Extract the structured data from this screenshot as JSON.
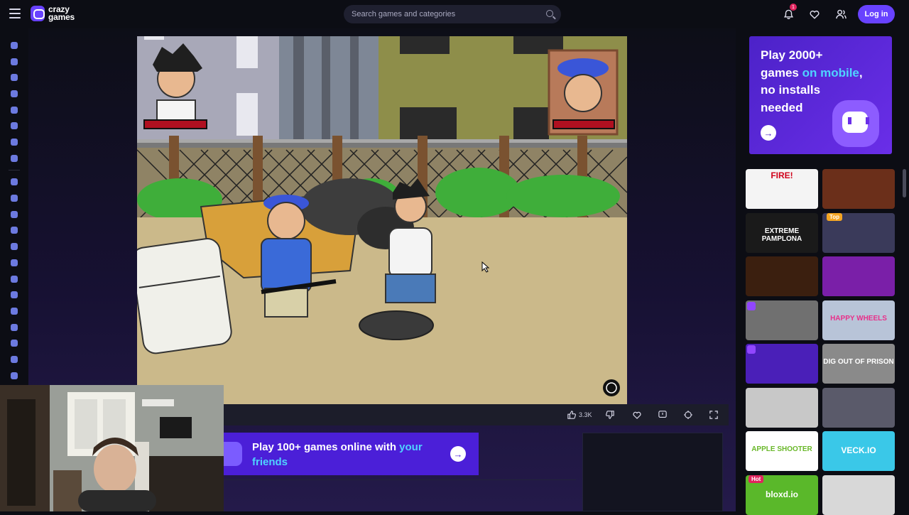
{
  "header": {
    "logo_line1": "crazy",
    "logo_line2": "games",
    "search_placeholder": "Search games and categories",
    "notification_count": "1",
    "login_label": "Log in"
  },
  "colors": {
    "accent": "#6842ff",
    "banner": "#4b1fd8",
    "highlight": "#4fd3ff",
    "badge_red": "#e0245e"
  },
  "sidebar": {
    "icons": [
      "home-icon",
      "recent-icon",
      "new-icon",
      "trending-icon",
      "updated-icon",
      "originals-icon",
      "multiplayer-icon",
      "leaderboard-icon",
      "action-icon",
      "adventure-icon",
      "basketball-icon",
      "beauty-icon",
      "car-icon",
      "clicker-icon",
      "casual-icon",
      "driving-icon",
      "controller-icon",
      "io-icon",
      "mahjong-icon",
      "puzzle-icon",
      "shooting-icon"
    ]
  },
  "game_toolbar": {
    "like_count": "3.3K",
    "icons": [
      "thumbs-up-icon",
      "thumbs-down-icon",
      "heart-icon",
      "report-icon",
      "theater-icon",
      "fullscreen-icon"
    ]
  },
  "bottom_banner": {
    "text_plain": "Play 100+ games online with ",
    "text_highlight": "your friends"
  },
  "promo": {
    "line1": "Play 2000+",
    "line2a": "games ",
    "line2b": "on mobile",
    "line2c": ",",
    "line3": "no installs",
    "line4": "needed"
  },
  "thumbnails": [
    {
      "name": "fire-game-thumb",
      "label": "FIRE!",
      "color": "#f4f4f4",
      "text": "#d0021b"
    },
    {
      "name": "boxing-game-thumb",
      "label": "",
      "color": "#6b2f1a",
      "text": "#fff"
    },
    {
      "name": "extreme-pamplona-thumb",
      "label": "EXTREME PAMPLONA",
      "color": "#1a1a1a",
      "text": "#fff"
    },
    {
      "name": "horror-game-thumb",
      "label": "",
      "color": "#3a3a5a",
      "text": "#fff",
      "tag": "Top"
    },
    {
      "name": "bottles-game-thumb",
      "label": "",
      "color": "#3b1f0f",
      "text": "#fff"
    },
    {
      "name": "dead-game-thumb",
      "label": "",
      "color": "#7a1fa8",
      "text": "#fff"
    },
    {
      "name": "archer-game-thumb",
      "label": "",
      "color": "#707070",
      "text": "#fff",
      "twitch": true
    },
    {
      "name": "happy-wheels-thumb",
      "label": "HAPPY WHEELS",
      "color": "#b8c4d8",
      "text": "#e8308a"
    },
    {
      "name": "wave-game-thumb",
      "label": "",
      "color": "#4a1fb8",
      "text": "#fff",
      "twitch": true
    },
    {
      "name": "dig-out-of-prison-thumb",
      "label": "DIG OUT OF PRISON",
      "color": "#8a8a8a",
      "text": "#fff"
    },
    {
      "name": "stickman-game-thumb",
      "label": "",
      "color": "#c8c8c8",
      "text": "#333"
    },
    {
      "name": "moto-game-thumb",
      "label": "",
      "color": "#5a5a6a",
      "text": "#fff"
    },
    {
      "name": "apple-shooter-thumb",
      "label": "APPLE SHOOTER",
      "color": "#ffffff",
      "text": "#6ab82a"
    },
    {
      "name": "veck-io-thumb",
      "label": "VECK.IO",
      "color": "#3ac8e8",
      "text": "#fff"
    },
    {
      "name": "bloxd-io-thumb",
      "label": "bloxd.io",
      "color": "#5ab82a",
      "text": "#fff",
      "tag": "Hot"
    },
    {
      "name": "stickman-2-thumb",
      "label": "",
      "color": "#d8d8d8",
      "text": "#333"
    }
  ]
}
